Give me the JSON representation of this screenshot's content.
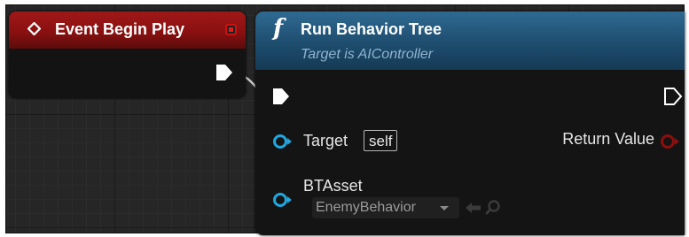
{
  "event_node": {
    "title": "Event Begin Play",
    "header_color": "#a01818",
    "icons": [
      "event-diamond-icon",
      "delegate-pin-icon",
      "exec-out-pin-icon"
    ]
  },
  "function_node": {
    "title": "Run Behavior Tree",
    "subtitle": "Target is AIController",
    "function_glyph": "f",
    "header_color": "#2f6a93",
    "pins": {
      "target": {
        "label": "Target",
        "default_value": "self"
      },
      "return_value": {
        "label": "Return Value"
      },
      "bt_asset": {
        "label": "BTAsset",
        "selected_value": "EnemyBehavior"
      }
    },
    "icons": [
      "exec-in-pin-icon",
      "exec-out-pin-icon",
      "object-pin-icon",
      "bool-pin-icon",
      "dropdown-arrow-icon",
      "use-selected-arrow-icon",
      "browse-magnifier-icon"
    ]
  },
  "colors": {
    "graph_background": "#262626",
    "object_pin": "#1fa7e0",
    "return_pin": "#8c0e0e",
    "wire": "#d0d0d0"
  }
}
